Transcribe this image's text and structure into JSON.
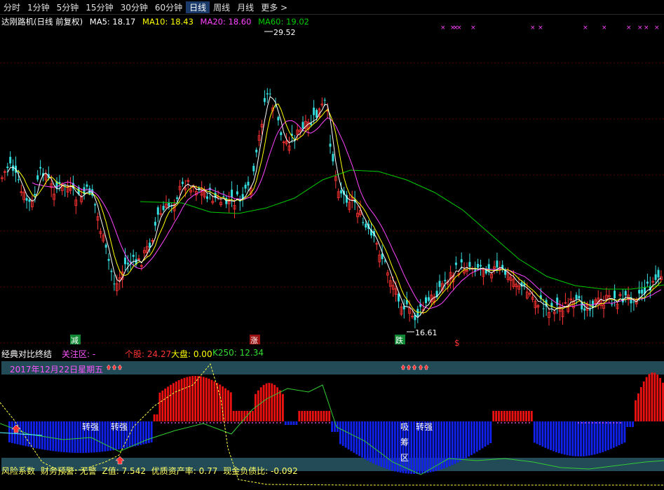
{
  "timeframes": [
    {
      "label": "分时",
      "active": false
    },
    {
      "label": "1分钟",
      "active": false
    },
    {
      "label": "5分钟",
      "active": false
    },
    {
      "label": "15分钟",
      "active": false
    },
    {
      "label": "30分钟",
      "active": false
    },
    {
      "label": "60分钟",
      "active": false
    },
    {
      "label": "日线",
      "active": true
    },
    {
      "label": "周线",
      "active": false
    },
    {
      "label": "月线",
      "active": false
    },
    {
      "label": "更多 >",
      "active": false
    }
  ],
  "legend": {
    "title": "达刚路机(日线 前复权)",
    "ma5": "MA5: 18.17",
    "ma10": "MA10: 18.43",
    "ma20": "MA20: 18.60",
    "ma60": "MA60: 19.02"
  },
  "price_annotations": {
    "high": "29.52",
    "low": "16.61"
  },
  "signals": {
    "jian": "减",
    "zhang": "涨",
    "die": "跌",
    "s": "$"
  },
  "indicator": {
    "name": "经典对比终结",
    "watch": "关注区: -",
    "stock": "个股: 24.27",
    "market": "大盘: 0.00",
    "k250": "K250: 12.34",
    "date": "2017年12月22日星期五",
    "label_zq1": "转强",
    "label_zq2": "转强",
    "label_zq3": "转强",
    "label_xi": "吸",
    "label_chou": "筹",
    "label_qu": "区"
  },
  "bottom": {
    "risk": "风险系数",
    "fin": "财务预警: 无警",
    "z": "Z值: 7.542",
    "quality": "优质资产率: 0.77",
    "cash": "现金负债比: -0.092"
  },
  "colors": {
    "up": "#ff3333",
    "down": "#33dddd",
    "ma5": "#ffffff",
    "ma10": "#ffff00",
    "ma20": "#ff44ff",
    "ma60": "#00cc00",
    "hist_up": "#ee1111",
    "hist_down": "#1122ee"
  }
}
